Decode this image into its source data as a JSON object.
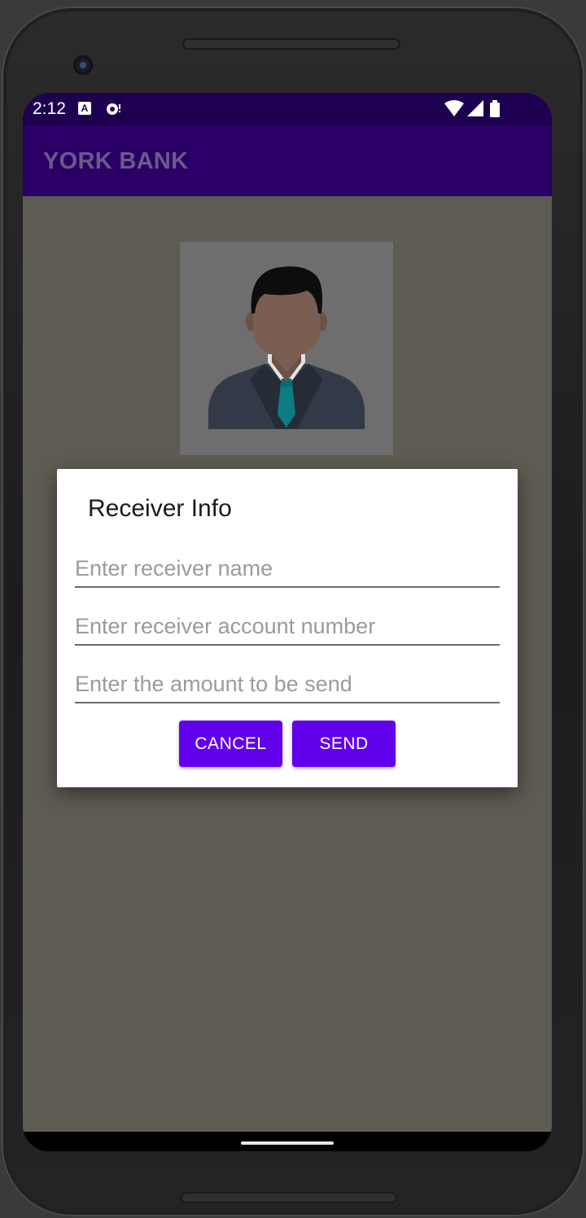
{
  "status_bar": {
    "time": "2:12",
    "notification_icons": [
      "a-box-icon",
      "sync-icon"
    ],
    "system_icons": [
      "wifi-icon",
      "cellular-signal-icon",
      "battery-icon"
    ]
  },
  "app_bar": {
    "title": "YORK BANK"
  },
  "profile": {
    "avatar_icon": "person-in-suit-icon"
  },
  "dialog": {
    "title": "Receiver Info",
    "fields": [
      {
        "placeholder": "Enter receiver name",
        "value": ""
      },
      {
        "placeholder": "Enter receiver account number",
        "value": ""
      },
      {
        "placeholder": "Enter the amount to be send",
        "value": ""
      }
    ],
    "buttons": {
      "cancel": "CANCEL",
      "send": "SEND"
    }
  },
  "colors": {
    "status_bar": "#1e0050",
    "app_bar": "#2a0066",
    "button": "#6200ee",
    "scrim_background": "#5e5b52"
  }
}
